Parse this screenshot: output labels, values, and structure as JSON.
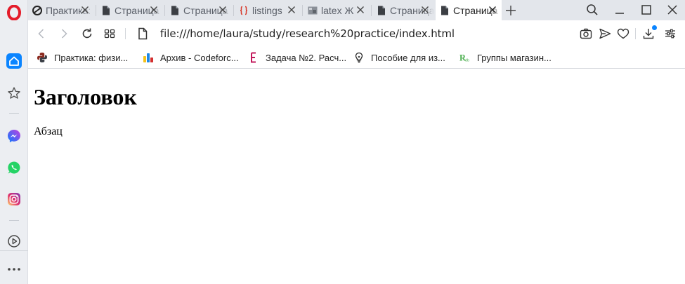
{
  "browser": {
    "tabs": [
      {
        "title": "Практика: физика",
        "icon": "opera-logo-icon",
        "active": false
      },
      {
        "title": "Страница",
        "icon": "document-icon",
        "active": false
      },
      {
        "title": "Страница",
        "icon": "document-icon",
        "active": false
      },
      {
        "title": "listings",
        "icon": "braces-icon",
        "active": false
      },
      {
        "title": "latex Ж",
        "icon": "image-icon",
        "active": false
      },
      {
        "title": "Страница",
        "icon": "document-icon",
        "active": false
      },
      {
        "title": "Страница",
        "icon": "document-icon",
        "active": true
      }
    ],
    "address": {
      "url": "file:///home/laura/study/research%20practice/index.html"
    },
    "bookmarks": [
      {
        "label": "Практика: физи...",
        "icon": "python-icon"
      },
      {
        "label": "Архив - Codeforc...",
        "icon": "codeforces-icon"
      },
      {
        "label": "Задача №2. Расч...",
        "icon": "e-letter-icon"
      },
      {
        "label": "Пособие для из...",
        "icon": "lightbulb-icon"
      },
      {
        "label": "Группы магазин...",
        "icon": "rdb-icon"
      }
    ],
    "colors": {
      "accent": "#0a84ff",
      "opera_red": "#e41c2a",
      "messenger": "#8a4dff",
      "whatsapp": "#25d366",
      "instagram": "#e1306c"
    }
  },
  "page": {
    "heading": "Заголовок",
    "paragraph": "Абзац"
  }
}
